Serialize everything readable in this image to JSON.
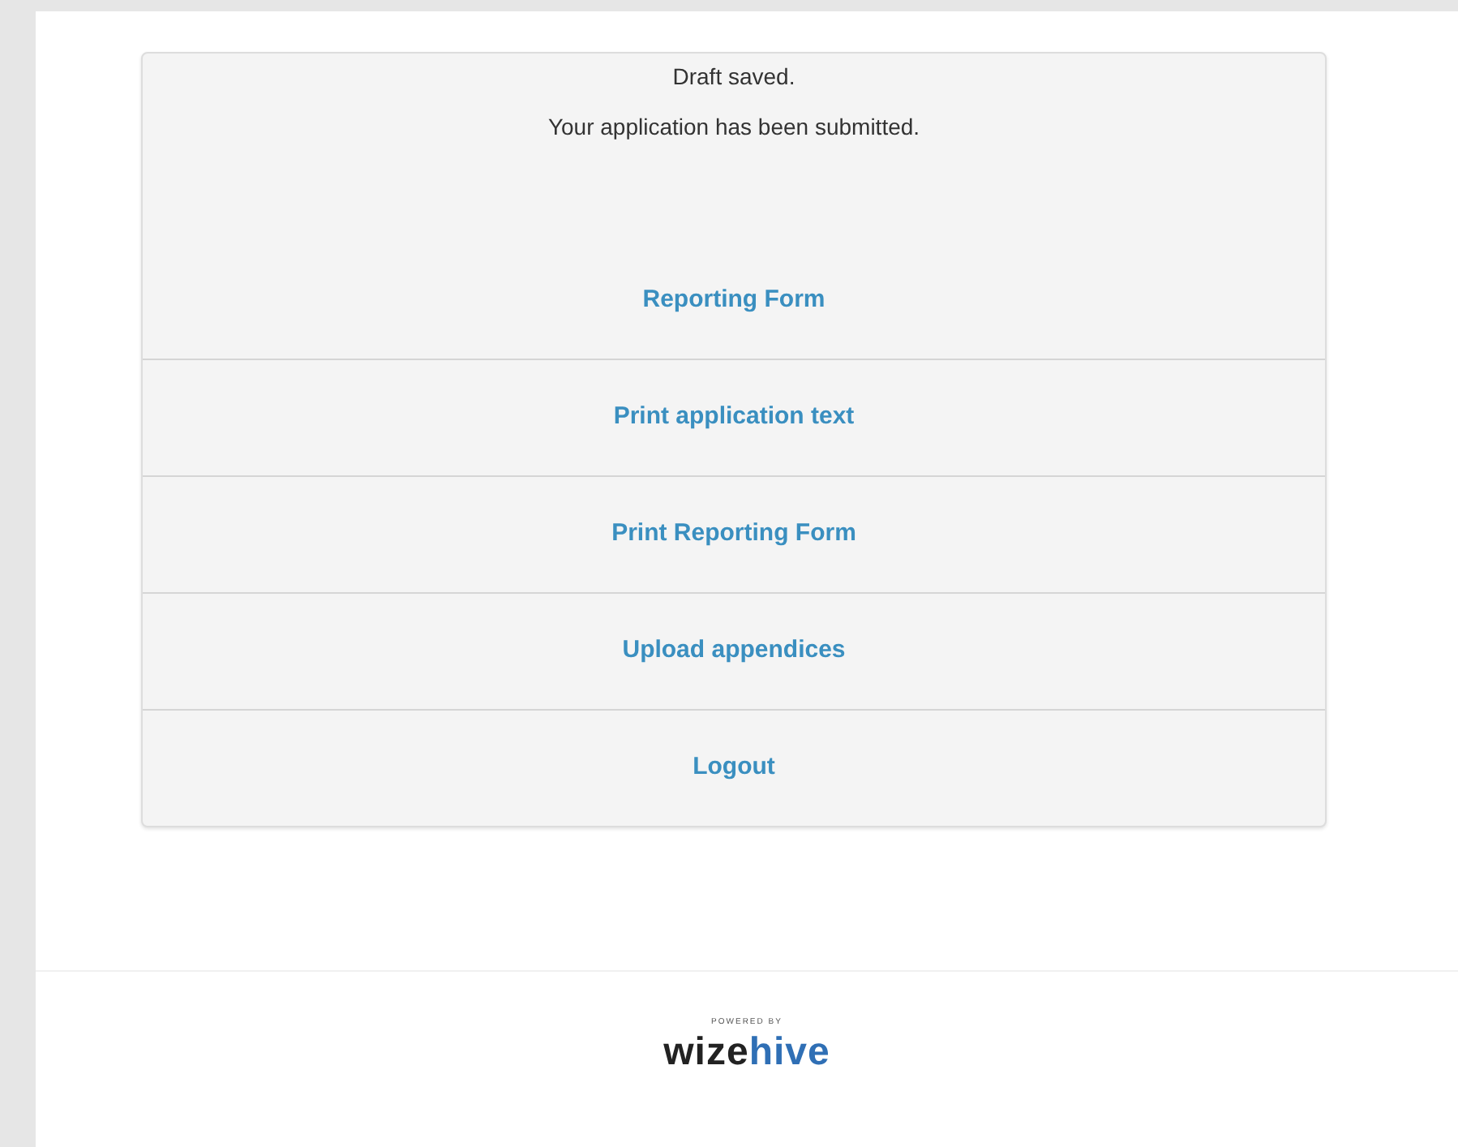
{
  "messages": [
    "Draft saved.",
    "Your application has been submitted."
  ],
  "actions": [
    {
      "label": "Reporting Form"
    },
    {
      "label": "Print application text"
    },
    {
      "label": "Print Reporting Form"
    },
    {
      "label": "Upload appendices"
    },
    {
      "label": "Logout"
    }
  ],
  "footer": {
    "tagline": "POWERED BY",
    "logo_parts": [
      "wize",
      "hive"
    ]
  }
}
